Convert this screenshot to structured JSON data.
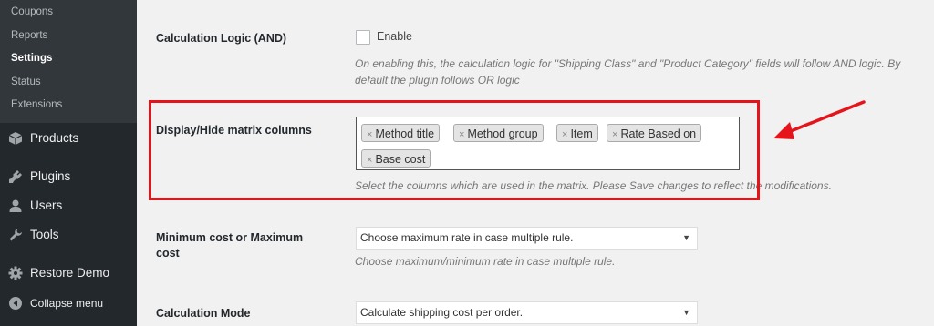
{
  "sidebar": {
    "submenu": [
      "Coupons",
      "Reports",
      "Settings",
      "Status",
      "Extensions"
    ],
    "current": "Settings",
    "menu": [
      {
        "label": "Products",
        "icon": "cube-icon"
      },
      {
        "label": "Plugins",
        "icon": "plug-icon"
      },
      {
        "label": "Users",
        "icon": "user-icon"
      },
      {
        "label": "Tools",
        "icon": "wrench-icon"
      },
      {
        "label": "Restore Demo",
        "icon": "gear-icon"
      },
      {
        "label": "Collapse menu",
        "icon": "collapse-icon"
      }
    ]
  },
  "settings": {
    "logic": {
      "label": "Calculation Logic (AND)",
      "checkbox_label": "Enable",
      "checked": false,
      "description": "On enabling this, the calculation logic for \"Shipping Class\" and \"Product Category\" fields will follow AND logic. By default the plugin follows OR logic"
    },
    "matrix": {
      "label": "Display/Hide matrix columns",
      "tags": [
        "Method title",
        "Method group",
        "Item",
        "Rate Based on",
        "Base cost"
      ],
      "remove_glyph": "×",
      "description": "Select the columns which are used in the matrix. Please Save changes to reflect the modifications."
    },
    "mincost": {
      "label": "Minimum cost or Maximum cost",
      "selected": "Choose maximum rate in case multiple rule.",
      "description": "Choose maximum/minimum rate in case multiple rule."
    },
    "mode": {
      "label": "Calculation Mode",
      "selected": "Calculate shipping cost per order."
    }
  },
  "colors": {
    "annotation": "#e5141b",
    "sidebar_bg": "#23282d",
    "submenu_bg": "#32373c"
  }
}
